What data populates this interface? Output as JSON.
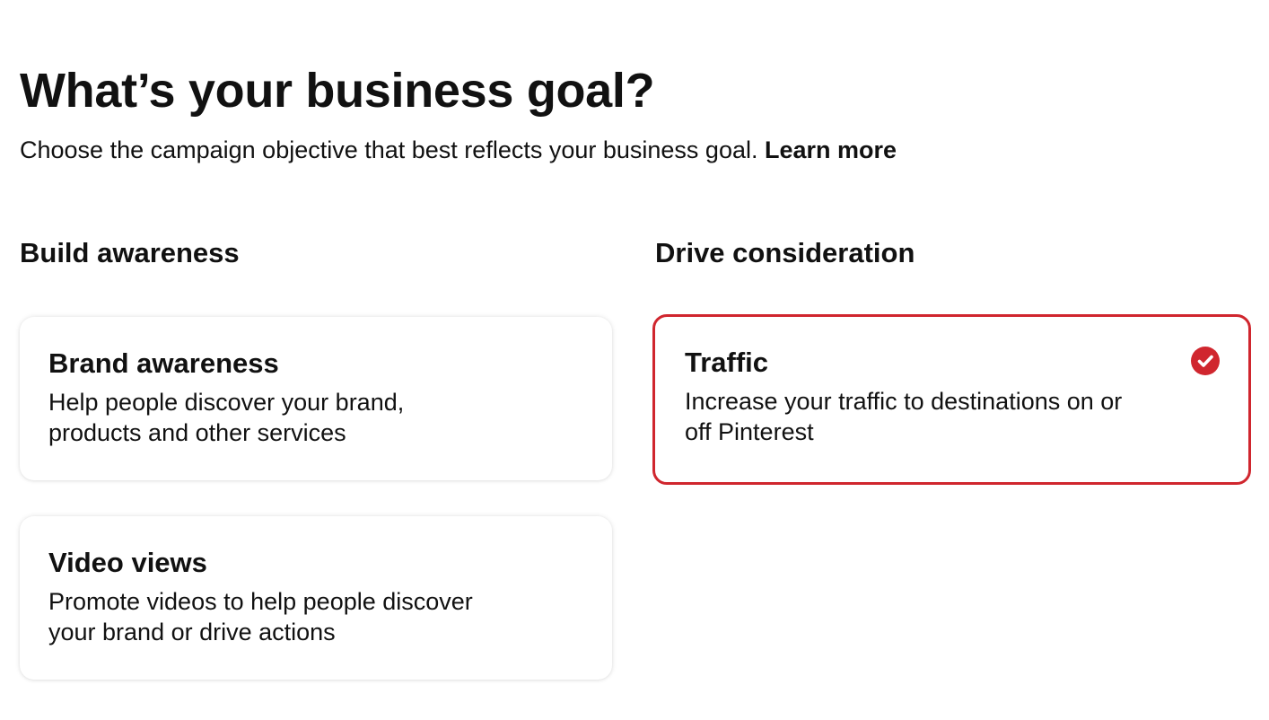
{
  "header": {
    "title": "What’s your business goal?",
    "subtitle": "Choose the campaign objective that best reflects your business goal.",
    "learn_more": "Learn more"
  },
  "sections": [
    {
      "heading": "Build awareness",
      "cards": [
        {
          "title": "Brand awareness",
          "description_lines": [
            "Help people discover your brand,",
            "products and other services"
          ],
          "selected": false
        },
        {
          "title": "Video views",
          "description_lines": [
            "Promote videos to help people discover",
            "your brand or drive actions"
          ],
          "selected": false
        }
      ]
    },
    {
      "heading": "Drive consideration",
      "cards": [
        {
          "title": "Traffic",
          "description_lines": [
            "Increase your traffic to destinations on or",
            "off Pinterest"
          ],
          "selected": true,
          "icon": "checkmark-circle-icon"
        }
      ]
    }
  ],
  "colors": {
    "accent": "#d0262e",
    "text": "#111111",
    "background": "#ffffff"
  }
}
